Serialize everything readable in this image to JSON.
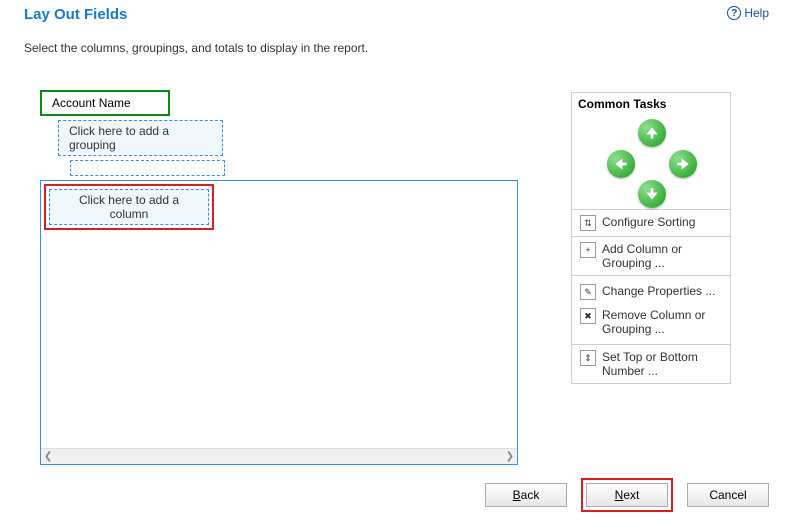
{
  "header": {
    "title": "Lay Out Fields",
    "help_label": "Help"
  },
  "description": "Select the columns, groupings, and totals to display in the report.",
  "layout": {
    "field_header": "Account Name",
    "add_grouping_label": "Click here to add a grouping",
    "add_column_label": "Click here to add a column"
  },
  "tasks": {
    "heading": "Common Tasks",
    "configure_sorting": "Configure Sorting",
    "add_column_grouping": "Add Column or Grouping ...",
    "change_properties": "Change Properties ...",
    "remove_column_grouping": "Remove Column or Grouping ...",
    "set_top_bottom": "Set Top or Bottom Number ..."
  },
  "footer": {
    "back": "Back",
    "next": "Next",
    "cancel": "Cancel"
  }
}
